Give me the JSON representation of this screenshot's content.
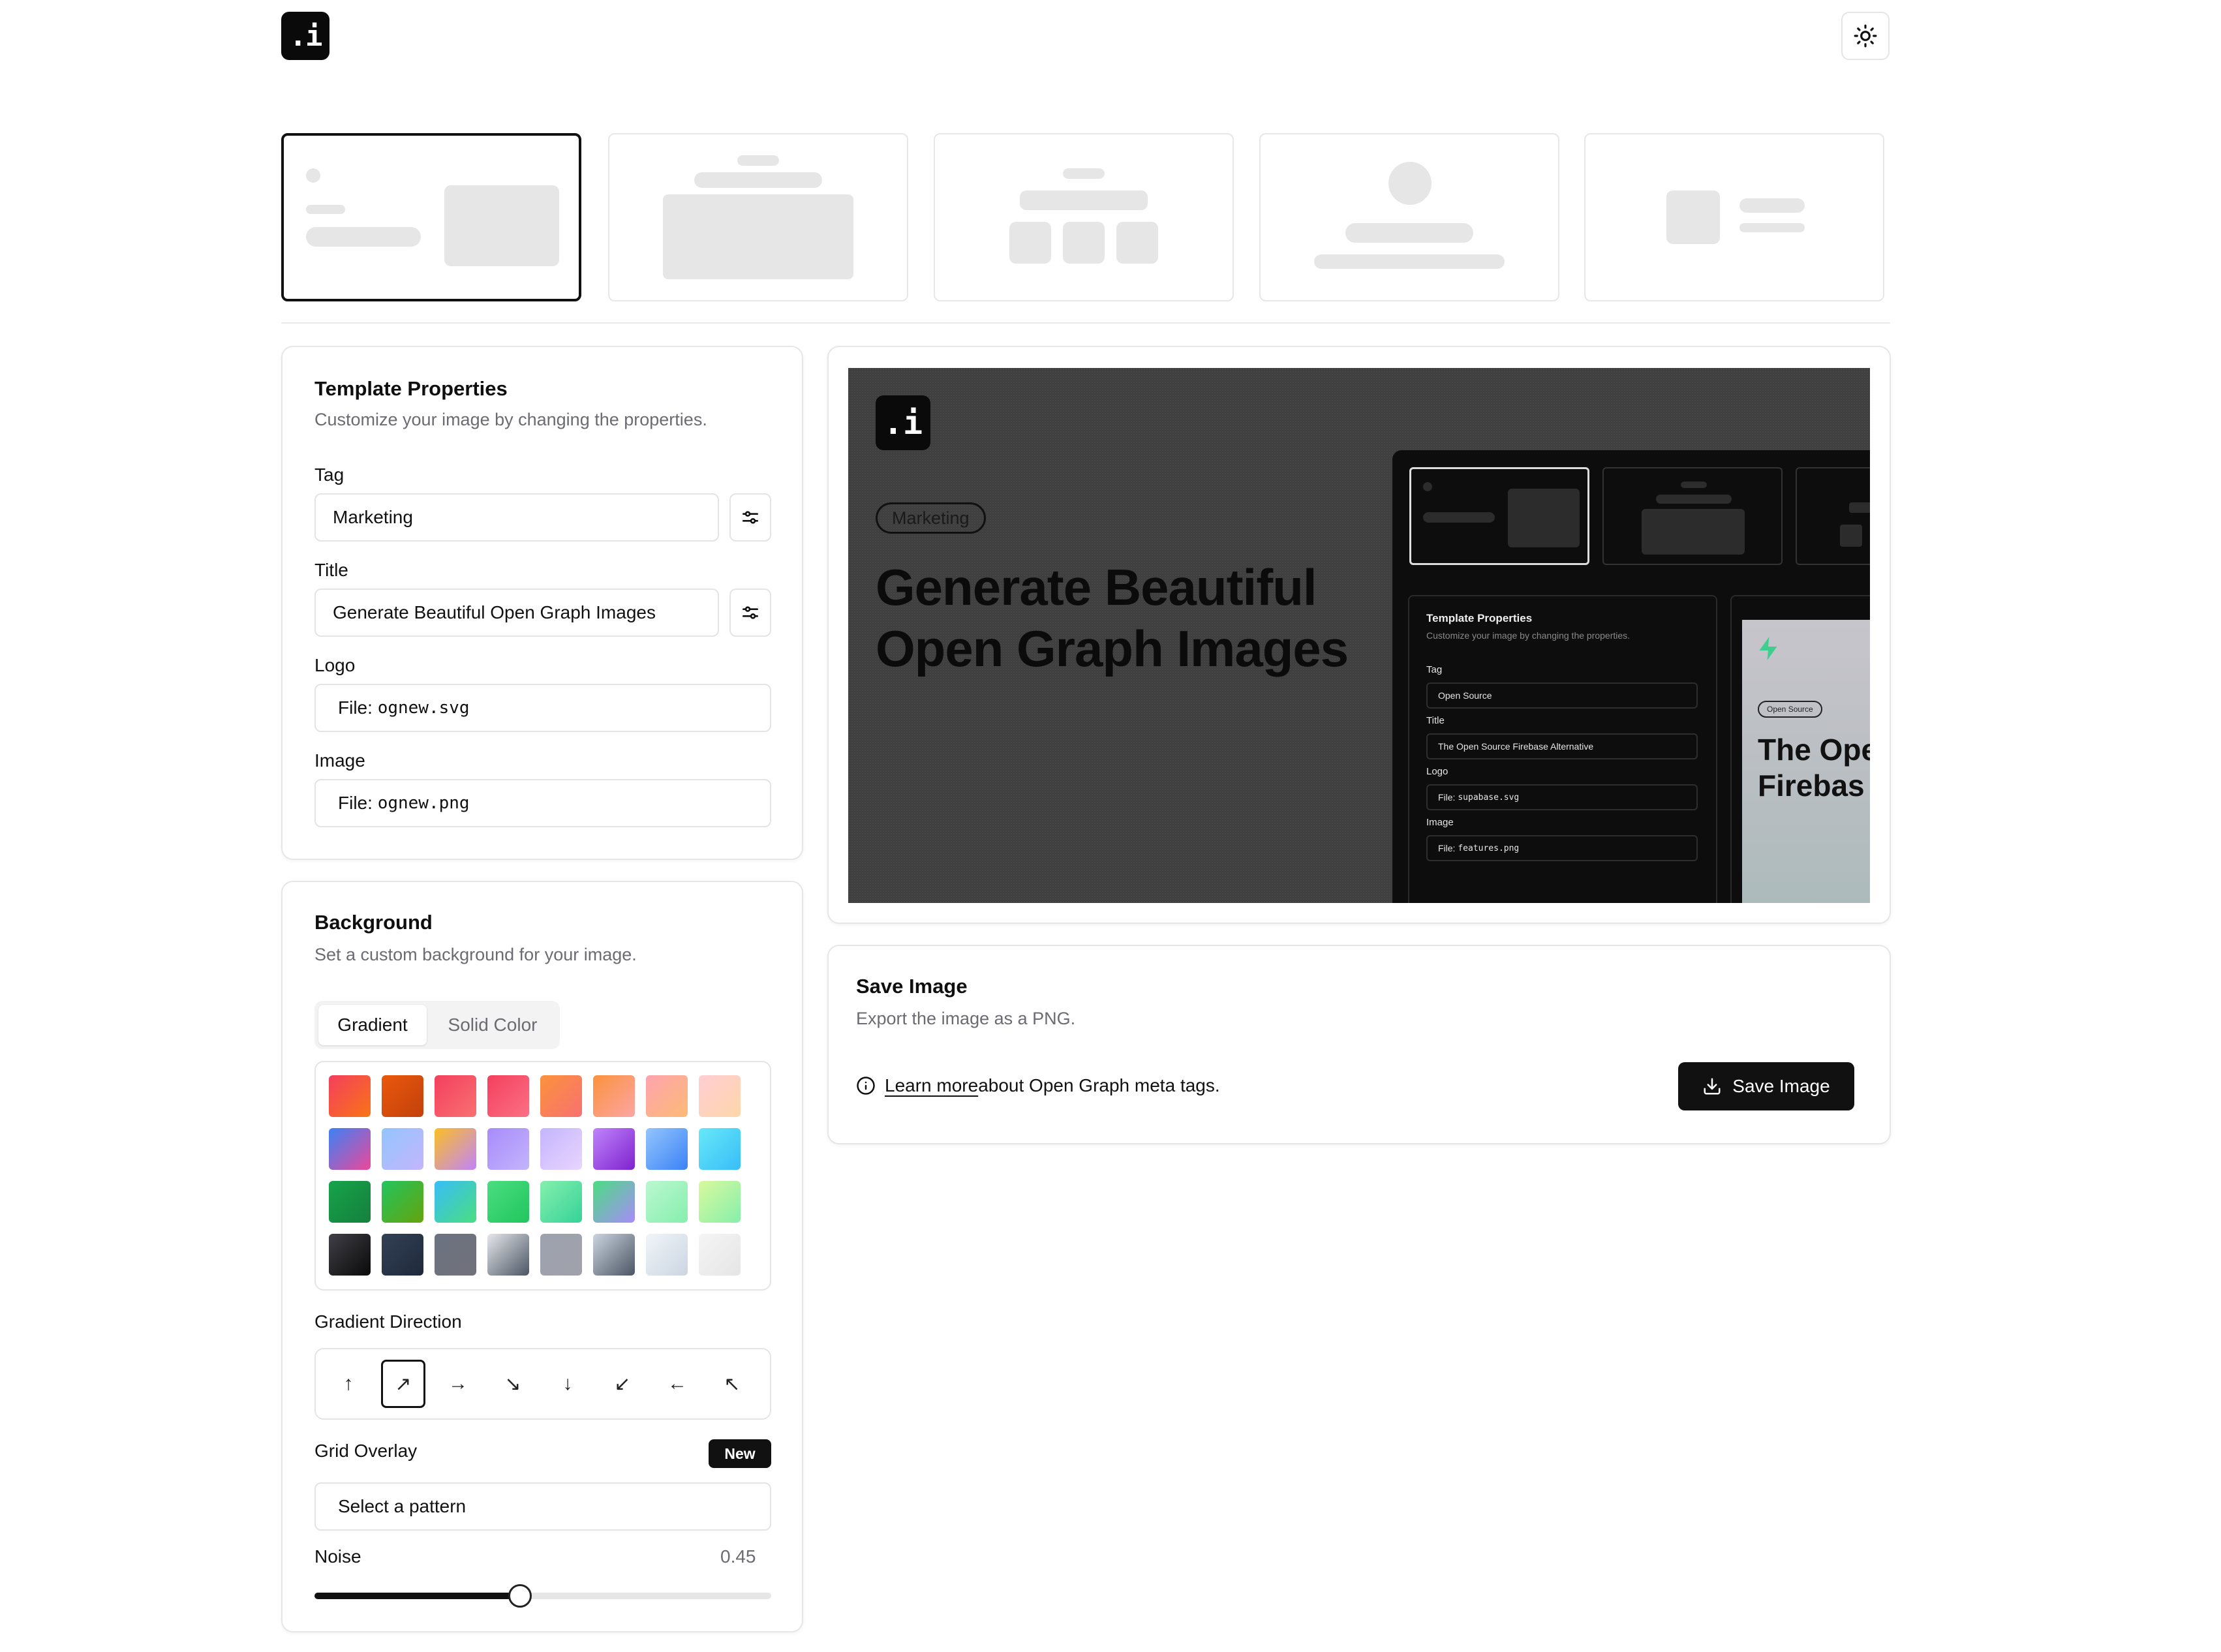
{
  "header": {
    "logo_text": ".i",
    "theme_toggle_icon": "sun-icon"
  },
  "templates": {
    "count": 5,
    "selected_index": 0
  },
  "template_properties": {
    "title": "Template Properties",
    "subtitle": "Customize your image by changing the properties.",
    "tag_label": "Tag",
    "tag_value": "Marketing",
    "title_label": "Title",
    "title_value": "Generate Beautiful Open Graph Images",
    "logo_label": "Logo",
    "logo_prefix": "File: ",
    "logo_file": "ognew.svg",
    "image_label": "Image",
    "image_prefix": "File: ",
    "image_file": "ognew.png"
  },
  "background": {
    "title": "Background",
    "subtitle": "Set a custom background for your image.",
    "tabs": [
      "Gradient",
      "Solid Color"
    ],
    "active_tab": "Gradient",
    "gradient_direction_label": "Gradient Direction",
    "directions": [
      "↑",
      "↗",
      "→",
      "↘",
      "↓",
      "↙",
      "←",
      "↖"
    ],
    "selected_direction_index": 1,
    "grid_overlay_label": "Grid Overlay",
    "new_badge": "New",
    "pattern_value": "Select a pattern",
    "noise_label": "Noise",
    "noise_value": "0.45"
  },
  "preview": {
    "logo_text": ".i",
    "tag": "Marketing",
    "title_line1": "Generate Beautiful",
    "title_line2": "Open Graph Images",
    "embedded": {
      "card_title": "Template Properties",
      "card_sub": "Customize your image by changing the properties.",
      "tag_label": "Tag",
      "tag_value": "Open Source",
      "title_label": "Title",
      "title_value": "The Open Source Firebase Alternative",
      "logo_label": "Logo",
      "logo_prefix": "File: ",
      "logo_file": "supabase.svg",
      "image_label": "Image",
      "image_prefix": "File: ",
      "image_file": "features.png",
      "preview_tag": "Open Source",
      "preview_title_line1": "The Ope",
      "preview_title_line2": "Firebas"
    }
  },
  "save": {
    "title": "Save Image",
    "subtitle": "Export the image as a PNG.",
    "learn_more": "Learn more",
    "info_text": "about Open Graph meta tags.",
    "button_label": "Save Image"
  },
  "colors": {
    "accent": "#111111",
    "border": "#e6e6e6",
    "muted_text": "#6b6b72",
    "preview_bg": "#3f3f3f"
  }
}
